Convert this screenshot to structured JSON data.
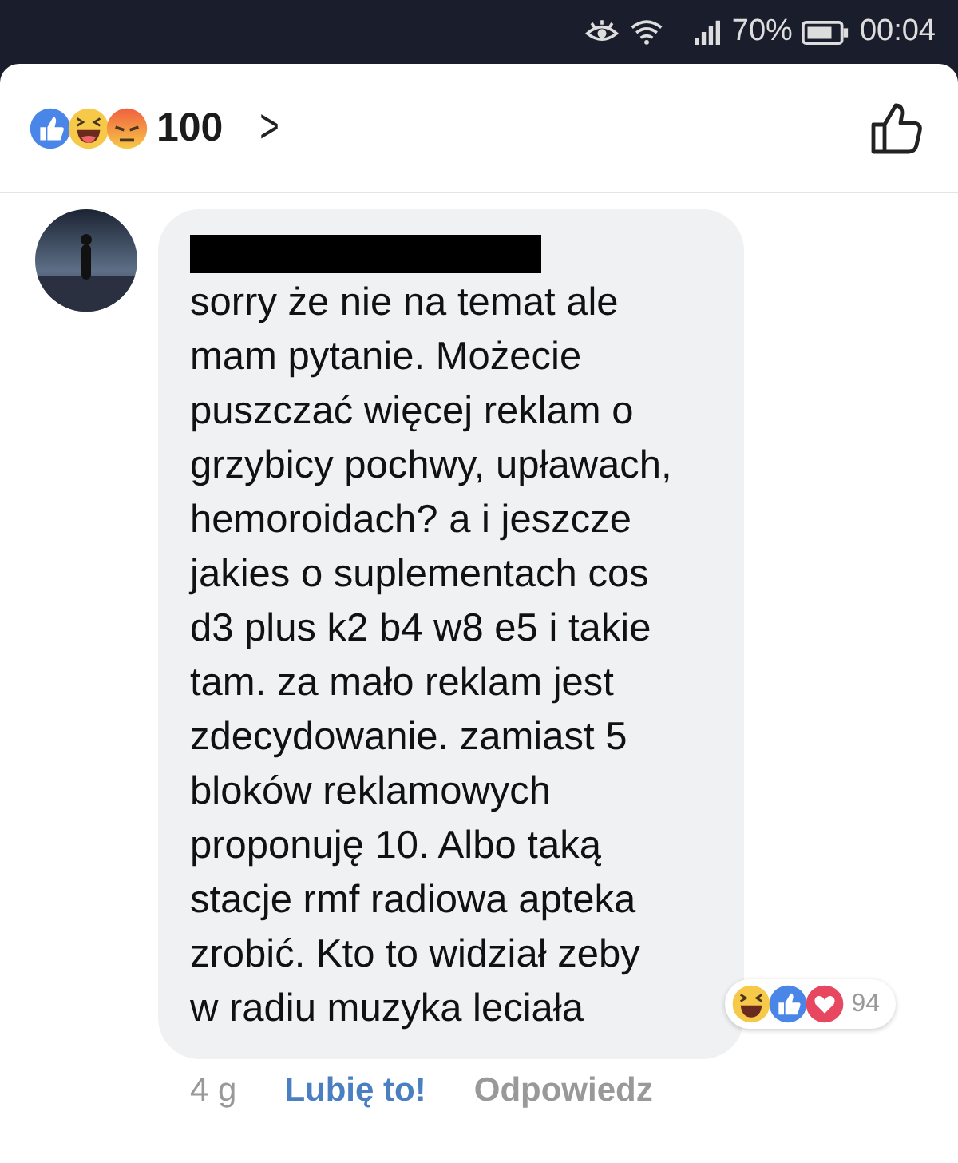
{
  "status_bar": {
    "battery_text": "70%",
    "time": "00:04"
  },
  "post_reactions": {
    "icons": [
      {
        "kind": "like"
      },
      {
        "kind": "haha"
      },
      {
        "kind": "angry"
      }
    ],
    "count": "100",
    "arrow": ">"
  },
  "comment": {
    "text": "sorry że nie na temat ale\nmam pytanie. Możecie\npuszczać więcej reklam o\ngrzybicy pochwy, upławach,\nhemoroidach? a i jeszcze\njakies o suplementach cos\nd3 plus k2 b4 w8 e5 i takie\ntam. za mało reklam jest\nzdecydowanie. zamiast 5\nbloków reklamowych\nproponuję 10. Albo taką\nstacje rmf radiowa apteka\nzrobić. Kto to widział zeby\nw radiu muzyka leciała",
    "reactions": {
      "icons": [
        {
          "kind": "haha"
        },
        {
          "kind": "like"
        },
        {
          "kind": "love"
        }
      ],
      "count": "94"
    },
    "time": "4 g",
    "like_label": "Lubię to!",
    "liked": true,
    "reply_label": "Odpowiedz"
  }
}
